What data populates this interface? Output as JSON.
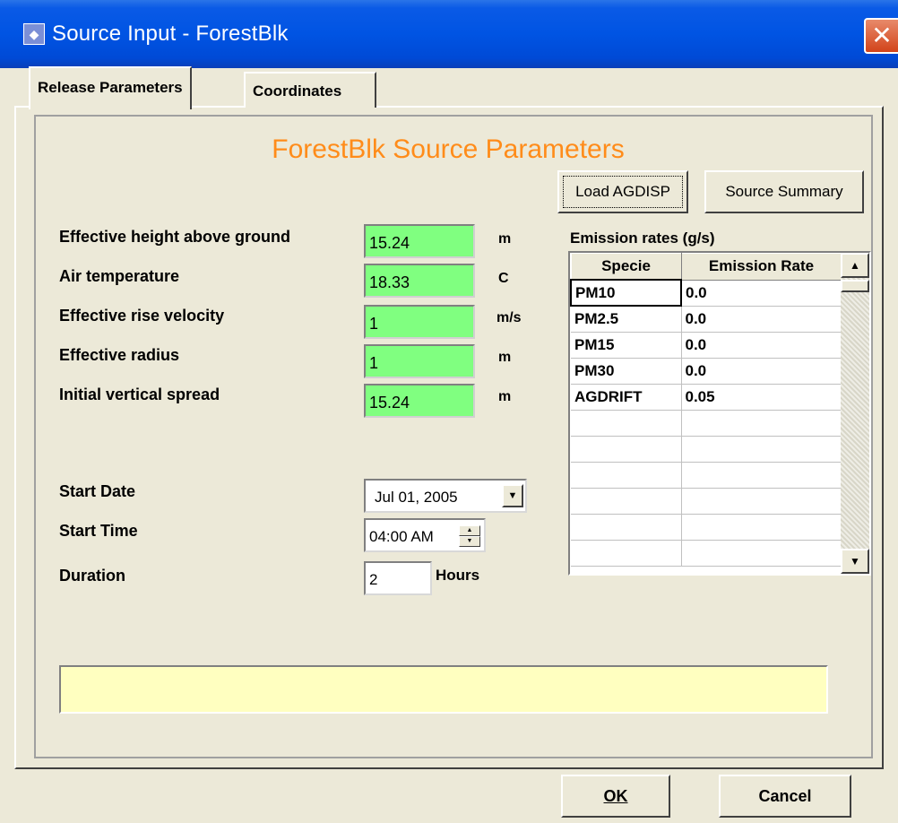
{
  "window": {
    "title": "Source Input - ForestBlk",
    "close_glyph": "✕"
  },
  "tabs": [
    {
      "label": "Release Parameters",
      "active": true
    },
    {
      "label": "Coordinates",
      "active": false
    }
  ],
  "heading": "ForestBlk Source Parameters",
  "buttons": {
    "load_agdisp": "Load AGDISP",
    "source_summary": "Source Summary",
    "ok": "OK",
    "cancel": "Cancel"
  },
  "parameters": [
    {
      "label": "Effective height above ground",
      "value": "15.24",
      "unit": "m"
    },
    {
      "label": "Air temperature",
      "value": "18.33",
      "unit": "C"
    },
    {
      "label": "Effective rise velocity",
      "value": "1",
      "unit": "m/s"
    },
    {
      "label": "Effective radius",
      "value": "1",
      "unit": "m"
    },
    {
      "label": "Initial vertical spread",
      "value": "15.24",
      "unit": "m"
    }
  ],
  "schedule": {
    "start_date_label": "Start Date",
    "start_date_value": "Jul  01, 2005",
    "start_time_label": "Start Time",
    "start_time_value": "04:00 AM",
    "duration_label": "Duration",
    "duration_value": "2",
    "duration_unit": "Hours"
  },
  "emissions": {
    "title": "Emission rates (g/s)",
    "columns": [
      "Specie",
      "Emission Rate"
    ],
    "rows": [
      {
        "specie": "PM10",
        "rate": "0.0"
      },
      {
        "specie": "PM2.5",
        "rate": "0.0"
      },
      {
        "specie": "PM15",
        "rate": "0.0"
      },
      {
        "specie": "PM30",
        "rate": "0.0"
      },
      {
        "specie": "AGDRIFT",
        "rate": "0.05"
      }
    ],
    "empty_rows": 6
  },
  "status_text": "",
  "colors": {
    "heading": "#ff8c1a",
    "input_bg": "#80ff80",
    "status_bg": "#ffffc0",
    "titlebar": "#0054e3"
  },
  "icons": {
    "app": "app-icon",
    "close": "close-icon",
    "dropdown": "chevron-down-icon",
    "spin": "spin-icon",
    "scroll_up": "scroll-up-icon",
    "scroll_down": "scroll-down-icon"
  }
}
